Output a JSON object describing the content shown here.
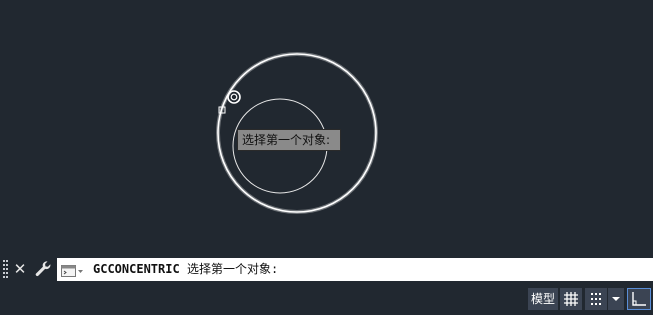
{
  "drawing": {
    "tooltip_text": "选择第一个对象:"
  },
  "command_line": {
    "command": "GCCONCENTRIC",
    "prompt": "选择第一个对象:",
    "close_icon": "close-icon",
    "customize_icon": "wrench-icon"
  },
  "status_bar": {
    "model_tab_label": "模型",
    "icons": [
      "grid-icon",
      "snap-icon",
      "chevron-down-icon",
      "ortho-icon"
    ],
    "active_color": "#5a8ed8"
  },
  "colors": {
    "background": "#212830",
    "circle_stroke": "#ffffff",
    "command_input_bg": "#ffffff"
  }
}
